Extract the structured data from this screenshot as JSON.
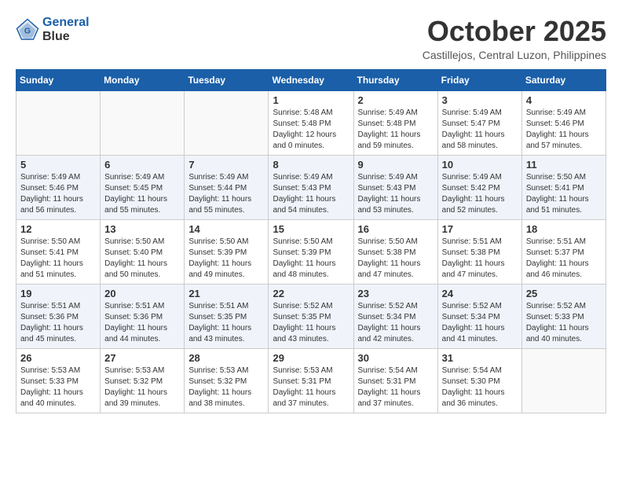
{
  "logo": {
    "line1": "General",
    "line2": "Blue"
  },
  "title": "October 2025",
  "subtitle": "Castillejos, Central Luzon, Philippines",
  "days_of_week": [
    "Sunday",
    "Monday",
    "Tuesday",
    "Wednesday",
    "Thursday",
    "Friday",
    "Saturday"
  ],
  "weeks": [
    [
      {
        "day": "",
        "info": ""
      },
      {
        "day": "",
        "info": ""
      },
      {
        "day": "",
        "info": ""
      },
      {
        "day": "1",
        "info": "Sunrise: 5:48 AM\nSunset: 5:48 PM\nDaylight: 12 hours\nand 0 minutes."
      },
      {
        "day": "2",
        "info": "Sunrise: 5:49 AM\nSunset: 5:48 PM\nDaylight: 11 hours\nand 59 minutes."
      },
      {
        "day": "3",
        "info": "Sunrise: 5:49 AM\nSunset: 5:47 PM\nDaylight: 11 hours\nand 58 minutes."
      },
      {
        "day": "4",
        "info": "Sunrise: 5:49 AM\nSunset: 5:46 PM\nDaylight: 11 hours\nand 57 minutes."
      }
    ],
    [
      {
        "day": "5",
        "info": "Sunrise: 5:49 AM\nSunset: 5:46 PM\nDaylight: 11 hours\nand 56 minutes."
      },
      {
        "day": "6",
        "info": "Sunrise: 5:49 AM\nSunset: 5:45 PM\nDaylight: 11 hours\nand 55 minutes."
      },
      {
        "day": "7",
        "info": "Sunrise: 5:49 AM\nSunset: 5:44 PM\nDaylight: 11 hours\nand 55 minutes."
      },
      {
        "day": "8",
        "info": "Sunrise: 5:49 AM\nSunset: 5:43 PM\nDaylight: 11 hours\nand 54 minutes."
      },
      {
        "day": "9",
        "info": "Sunrise: 5:49 AM\nSunset: 5:43 PM\nDaylight: 11 hours\nand 53 minutes."
      },
      {
        "day": "10",
        "info": "Sunrise: 5:49 AM\nSunset: 5:42 PM\nDaylight: 11 hours\nand 52 minutes."
      },
      {
        "day": "11",
        "info": "Sunrise: 5:50 AM\nSunset: 5:41 PM\nDaylight: 11 hours\nand 51 minutes."
      }
    ],
    [
      {
        "day": "12",
        "info": "Sunrise: 5:50 AM\nSunset: 5:41 PM\nDaylight: 11 hours\nand 51 minutes."
      },
      {
        "day": "13",
        "info": "Sunrise: 5:50 AM\nSunset: 5:40 PM\nDaylight: 11 hours\nand 50 minutes."
      },
      {
        "day": "14",
        "info": "Sunrise: 5:50 AM\nSunset: 5:39 PM\nDaylight: 11 hours\nand 49 minutes."
      },
      {
        "day": "15",
        "info": "Sunrise: 5:50 AM\nSunset: 5:39 PM\nDaylight: 11 hours\nand 48 minutes."
      },
      {
        "day": "16",
        "info": "Sunrise: 5:50 AM\nSunset: 5:38 PM\nDaylight: 11 hours\nand 47 minutes."
      },
      {
        "day": "17",
        "info": "Sunrise: 5:51 AM\nSunset: 5:38 PM\nDaylight: 11 hours\nand 47 minutes."
      },
      {
        "day": "18",
        "info": "Sunrise: 5:51 AM\nSunset: 5:37 PM\nDaylight: 11 hours\nand 46 minutes."
      }
    ],
    [
      {
        "day": "19",
        "info": "Sunrise: 5:51 AM\nSunset: 5:36 PM\nDaylight: 11 hours\nand 45 minutes."
      },
      {
        "day": "20",
        "info": "Sunrise: 5:51 AM\nSunset: 5:36 PM\nDaylight: 11 hours\nand 44 minutes."
      },
      {
        "day": "21",
        "info": "Sunrise: 5:51 AM\nSunset: 5:35 PM\nDaylight: 11 hours\nand 43 minutes."
      },
      {
        "day": "22",
        "info": "Sunrise: 5:52 AM\nSunset: 5:35 PM\nDaylight: 11 hours\nand 43 minutes."
      },
      {
        "day": "23",
        "info": "Sunrise: 5:52 AM\nSunset: 5:34 PM\nDaylight: 11 hours\nand 42 minutes."
      },
      {
        "day": "24",
        "info": "Sunrise: 5:52 AM\nSunset: 5:34 PM\nDaylight: 11 hours\nand 41 minutes."
      },
      {
        "day": "25",
        "info": "Sunrise: 5:52 AM\nSunset: 5:33 PM\nDaylight: 11 hours\nand 40 minutes."
      }
    ],
    [
      {
        "day": "26",
        "info": "Sunrise: 5:53 AM\nSunset: 5:33 PM\nDaylight: 11 hours\nand 40 minutes."
      },
      {
        "day": "27",
        "info": "Sunrise: 5:53 AM\nSunset: 5:32 PM\nDaylight: 11 hours\nand 39 minutes."
      },
      {
        "day": "28",
        "info": "Sunrise: 5:53 AM\nSunset: 5:32 PM\nDaylight: 11 hours\nand 38 minutes."
      },
      {
        "day": "29",
        "info": "Sunrise: 5:53 AM\nSunset: 5:31 PM\nDaylight: 11 hours\nand 37 minutes."
      },
      {
        "day": "30",
        "info": "Sunrise: 5:54 AM\nSunset: 5:31 PM\nDaylight: 11 hours\nand 37 minutes."
      },
      {
        "day": "31",
        "info": "Sunrise: 5:54 AM\nSunset: 5:30 PM\nDaylight: 11 hours\nand 36 minutes."
      },
      {
        "day": "",
        "info": ""
      }
    ]
  ]
}
